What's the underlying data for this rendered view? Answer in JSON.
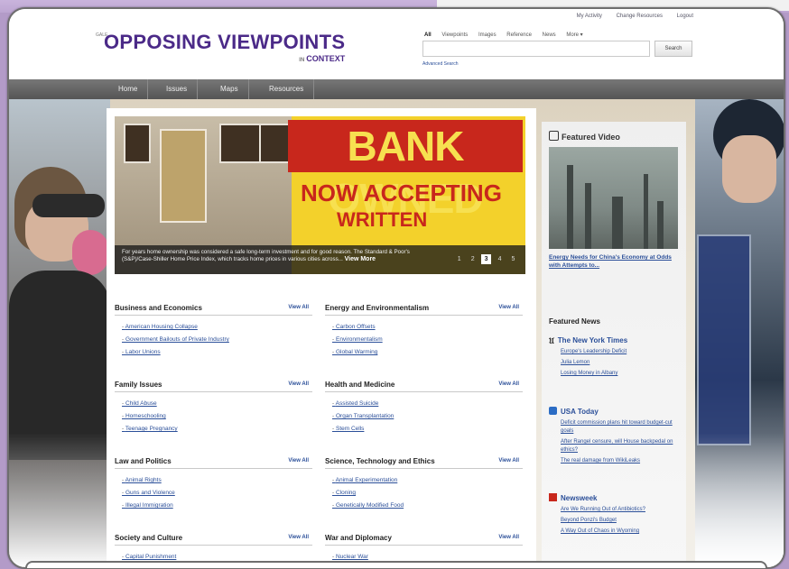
{
  "app": {
    "logo_prefix": "GALE",
    "logo_main": "OPPOSING VIEWPOINTS",
    "logo_in": "IN",
    "logo_context": "CONTEXT"
  },
  "utility_links": [
    "My Activity",
    "Change Resources",
    "Logout"
  ],
  "search": {
    "tabs": [
      "All",
      "Viewpoints",
      "Images",
      "Reference",
      "News",
      "More ▾"
    ],
    "selected_tab": "All",
    "value": "",
    "placeholder": "",
    "button": "Search",
    "advanced": "Advanced Search"
  },
  "nav": [
    "Home",
    "Issues",
    "Maps",
    "Resources"
  ],
  "hero": {
    "sign_line1": "BANK OWNED",
    "sign_line2": "NOW ACCEPTING",
    "sign_line3": "WRITTEN",
    "caption": "For years home ownership was considered a safe long-term investment and for good reason. The Standard & Poor's (S&P)/Case-Shiller Home Price Index, which tracks home prices in various cities across...",
    "view_more": "View More",
    "pages": [
      "1",
      "2",
      "3",
      "4",
      "5"
    ],
    "active_page": "3"
  },
  "view_all_label": "View All",
  "sections": [
    {
      "title": "Business and Economics",
      "items": [
        "American Housing Collapse",
        "Government Bailouts of Private Industry",
        "Labor Unions"
      ]
    },
    {
      "title": "Energy and Environmentalism",
      "items": [
        "Carbon Offsets",
        "Environmentalism",
        "Global Warming"
      ]
    },
    {
      "title": "Family Issues",
      "items": [
        "Child Abuse",
        "Homeschooling",
        "Teenage Pregnancy"
      ]
    },
    {
      "title": "Health and Medicine",
      "items": [
        "Assisted Suicide",
        "Organ Transplantation",
        "Stem Cells"
      ]
    },
    {
      "title": "Law and Politics",
      "items": [
        "Animal Rights",
        "Guns and Violence",
        "Illegal Immigration"
      ]
    },
    {
      "title": "Science, Technology and Ethics",
      "items": [
        "Animal Experimentation",
        "Cloning",
        "Genetically Modified Food"
      ]
    },
    {
      "title": "Society and Culture",
      "items": [
        "Capital Punishment"
      ]
    },
    {
      "title": "War and Diplomacy",
      "items": [
        "Nuclear War"
      ]
    }
  ],
  "sidebar": {
    "featured_video_title": "Featured Video",
    "video_caption": "Energy Needs for China's Economy at Odds with Attempts to...",
    "featured_news_title": "Featured News",
    "sources": [
      {
        "name": "The New York Times",
        "icon": "nyt-icon",
        "color": "#222222",
        "links": [
          "Europe's Leadership Deficit",
          "Julia Lemon",
          "Losing Money in Albany"
        ]
      },
      {
        "name": "USA Today",
        "icon": "usa-today-icon",
        "color": "#2b6cc4",
        "links": [
          "Deficit commission plans hit toward budget-cut goals",
          "After Rangel censure, will House backpedal on ethics?",
          "The real damage from WikiLeaks"
        ]
      },
      {
        "name": "Newsweek",
        "icon": "newsweek-icon",
        "color": "#c8271c",
        "links": [
          "Are We Running Out of Antibiotics?",
          "Beyond Ponzi's Budget",
          "A Way Out of Chaos in Wyoming"
        ]
      }
    ]
  }
}
